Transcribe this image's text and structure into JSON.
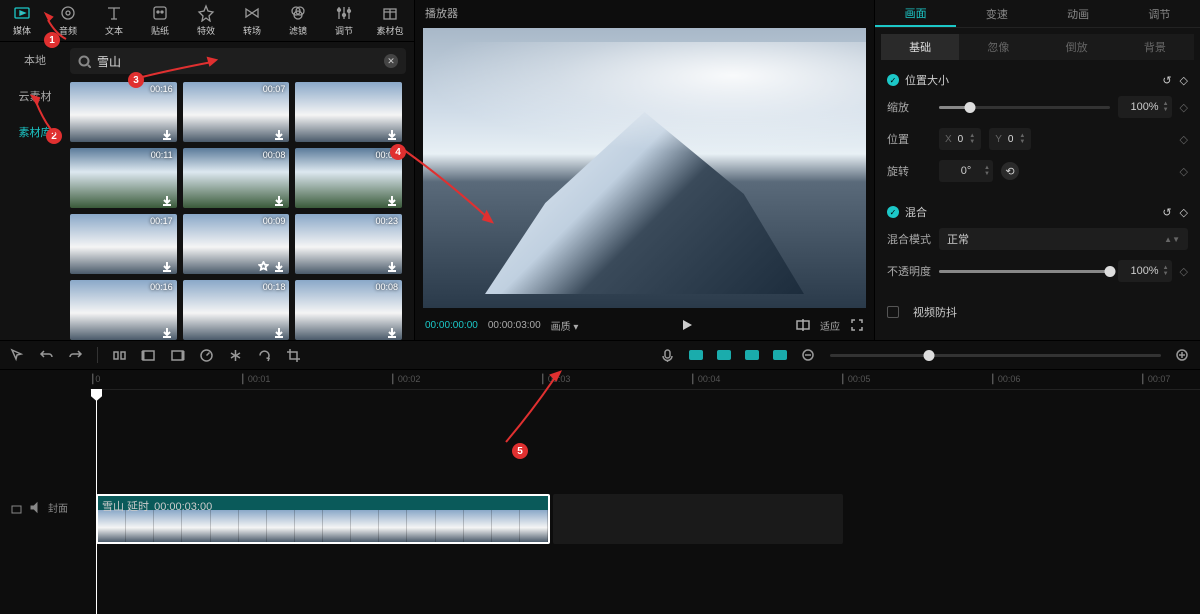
{
  "topTabs": [
    {
      "label": "媒体",
      "icon": "media",
      "active": true
    },
    {
      "label": "音频",
      "icon": "audio"
    },
    {
      "label": "文本",
      "icon": "text"
    },
    {
      "label": "贴纸",
      "icon": "sticker"
    },
    {
      "label": "特效",
      "icon": "effect"
    },
    {
      "label": "转场",
      "icon": "transition"
    },
    {
      "label": "滤镜",
      "icon": "filter"
    },
    {
      "label": "调节",
      "icon": "adjust"
    },
    {
      "label": "素材包",
      "icon": "pack"
    }
  ],
  "sideTabs": [
    {
      "label": "本地"
    },
    {
      "label": "云素材"
    },
    {
      "label": "素材库",
      "active": true
    }
  ],
  "search": {
    "placeholder": "",
    "value": "雪山"
  },
  "clips": [
    {
      "dur": "00:16",
      "snow": true
    },
    {
      "dur": "00:07",
      "snow": true
    },
    {
      "dur": "",
      "snow": true
    },
    {
      "dur": "00:11",
      "snow": false
    },
    {
      "dur": "00:08",
      "snow": false
    },
    {
      "dur": "00:07",
      "snow": false
    },
    {
      "dur": "00:17",
      "snow": true
    },
    {
      "dur": "00:09",
      "snow": true,
      "star": true
    },
    {
      "dur": "00:23",
      "snow": true
    },
    {
      "dur": "00:16",
      "snow": true
    },
    {
      "dur": "00:18",
      "snow": true
    },
    {
      "dur": "00:08",
      "snow": true
    }
  ],
  "player": {
    "title": "播放器",
    "time": "00:00:00:00",
    "duration": "00:00:03:00",
    "ratioLabel": "画质 ▾",
    "adapt": "适应"
  },
  "props": {
    "tabs": [
      "画面",
      "变速",
      "动画",
      "调节"
    ],
    "subTabs": [
      "基础",
      "忽像",
      "倒放",
      "背景"
    ],
    "posSize": "位置大小",
    "scale": {
      "label": "缩放",
      "value": "100%"
    },
    "position": {
      "label": "位置",
      "x": "0",
      "y": "0"
    },
    "rotation": {
      "label": "旋转",
      "value": "0°"
    },
    "blend": "混合",
    "blendMode": {
      "label": "混合模式",
      "value": "正常"
    },
    "opacity": {
      "label": "不透明度",
      "value": "100%"
    },
    "stabilize": "视频防抖"
  },
  "ruler": [
    "0",
    "00:01",
    "00:02",
    "00:03",
    "00:04",
    "00:05",
    "00:06",
    "00:07"
  ],
  "trackClip": {
    "name": "雪山 延时",
    "dur": "00:00:03:00"
  },
  "coverLabel": "封面",
  "badges": [
    "1",
    "2",
    "3",
    "4",
    "5"
  ]
}
